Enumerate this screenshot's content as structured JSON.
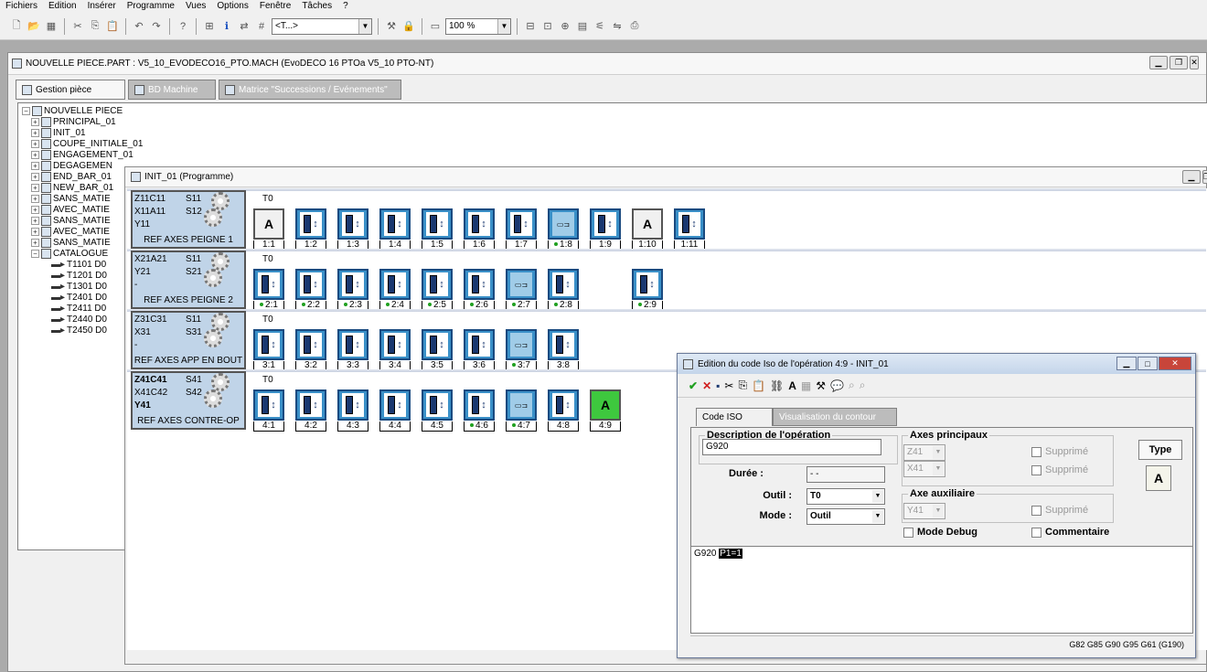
{
  "menu": [
    "Fichiers",
    "Edition",
    "Insérer",
    "Programme",
    "Vues",
    "Options",
    "Fenêtre",
    "Tâches",
    "?"
  ],
  "toolbar": {
    "combo1": "<T...>",
    "zoom": "100 %"
  },
  "main": {
    "title": "NOUVELLE PIECE.PART : V5_10_EVODECO16_PTO.MACH (EvoDECO 16 PTOa V5_10 PTO-NT)",
    "tabs": [
      {
        "label": "Gestion pièce"
      },
      {
        "label": "BD Machine"
      },
      {
        "label": "Matrice \"Successions / Evénements\""
      }
    ]
  },
  "tree": {
    "root": "NOUVELLE PIECE",
    "items": [
      "PRINCIPAL_01",
      "INIT_01",
      "COUPE_INITIALE_01",
      "ENGAGEMENT_01",
      "DEGAGEMEN",
      "END_BAR_01",
      "NEW_BAR_01",
      "SANS_MATIE",
      "AVEC_MATIE",
      "SANS_MATIE",
      "AVEC_MATIE",
      "SANS_MATIE"
    ],
    "catalogue": "CATALOGUE",
    "tools": [
      "T1101 D0",
      "T1201 D0",
      "T1301 D0",
      "T2401 D0",
      "T2411 D0",
      "T2440 D0",
      "T2450 D0"
    ]
  },
  "program": {
    "title": "INIT_01 (Programme)",
    "t0": "T0",
    "lanes": [
      {
        "l1a": "Z11C11",
        "l1b": "S11",
        "l2a": "X11A11",
        "l2b": "S12",
        "l3": "Y11",
        "ref": "REF AXES PEIGNE 1",
        "labels": [
          "1:1",
          "1:2",
          "1:3",
          "1:4",
          "1:5",
          "1:6",
          "1:7",
          "1:8",
          "1:9",
          "1:10",
          "1:11"
        ]
      },
      {
        "l1a": "X21A21",
        "l1b": "S11",
        "l2a": "Y21",
        "l2b": "S21",
        "l3": "-",
        "ref": "REF AXES PEIGNE 2",
        "labels": [
          "2:1",
          "2:2",
          "2:3",
          "2:4",
          "2:5",
          "2:6",
          "2:7",
          "2:8",
          "2:9"
        ]
      },
      {
        "l1a": "Z31C31",
        "l1b": "S11",
        "l2a": "X31",
        "l2b": "S31",
        "l3": "-",
        "ref": "REF AXES APP EN BOUT",
        "labels": [
          "3:1",
          "3:2",
          "3:3",
          "3:4",
          "3:5",
          "3:6",
          "3:7",
          "3:8"
        ]
      },
      {
        "l1a": "Z41C41",
        "l1b": "S41",
        "l2a": "X41C42",
        "l2b": "S42",
        "l3": "Y41",
        "ref": "REF AXES CONTRE-OP",
        "labels": [
          "4:1",
          "4:2",
          "4:3",
          "4:4",
          "4:5",
          "4:6",
          "4:7",
          "4:8",
          "4:9"
        ]
      }
    ]
  },
  "iso": {
    "title": "Edition du code Iso de l'opération 4:9 - INIT_01",
    "tabs": [
      "Code ISO",
      "Visualisation du contour"
    ],
    "desc_label": "Description de l'opération",
    "desc_value": "G920",
    "duree_label": "Durée :",
    "duree_value": "- -",
    "outil_label": "Outil :",
    "outil_value": "T0",
    "mode_label": "Mode :",
    "mode_value": "Outil",
    "axes_label": "Axes principaux",
    "axe1": "Z41",
    "axe2": "X41",
    "aux_label": "Axe auxiliaire",
    "aux1": "Y41",
    "supprime": "Supprimé",
    "mode_debug": "Mode Debug",
    "commentaire": "Commentaire",
    "type_label": "Type",
    "code_prefix": "G920",
    "code_hl": "P1=1",
    "status": "G82 G85 G90 G95 G61 (G190)"
  }
}
